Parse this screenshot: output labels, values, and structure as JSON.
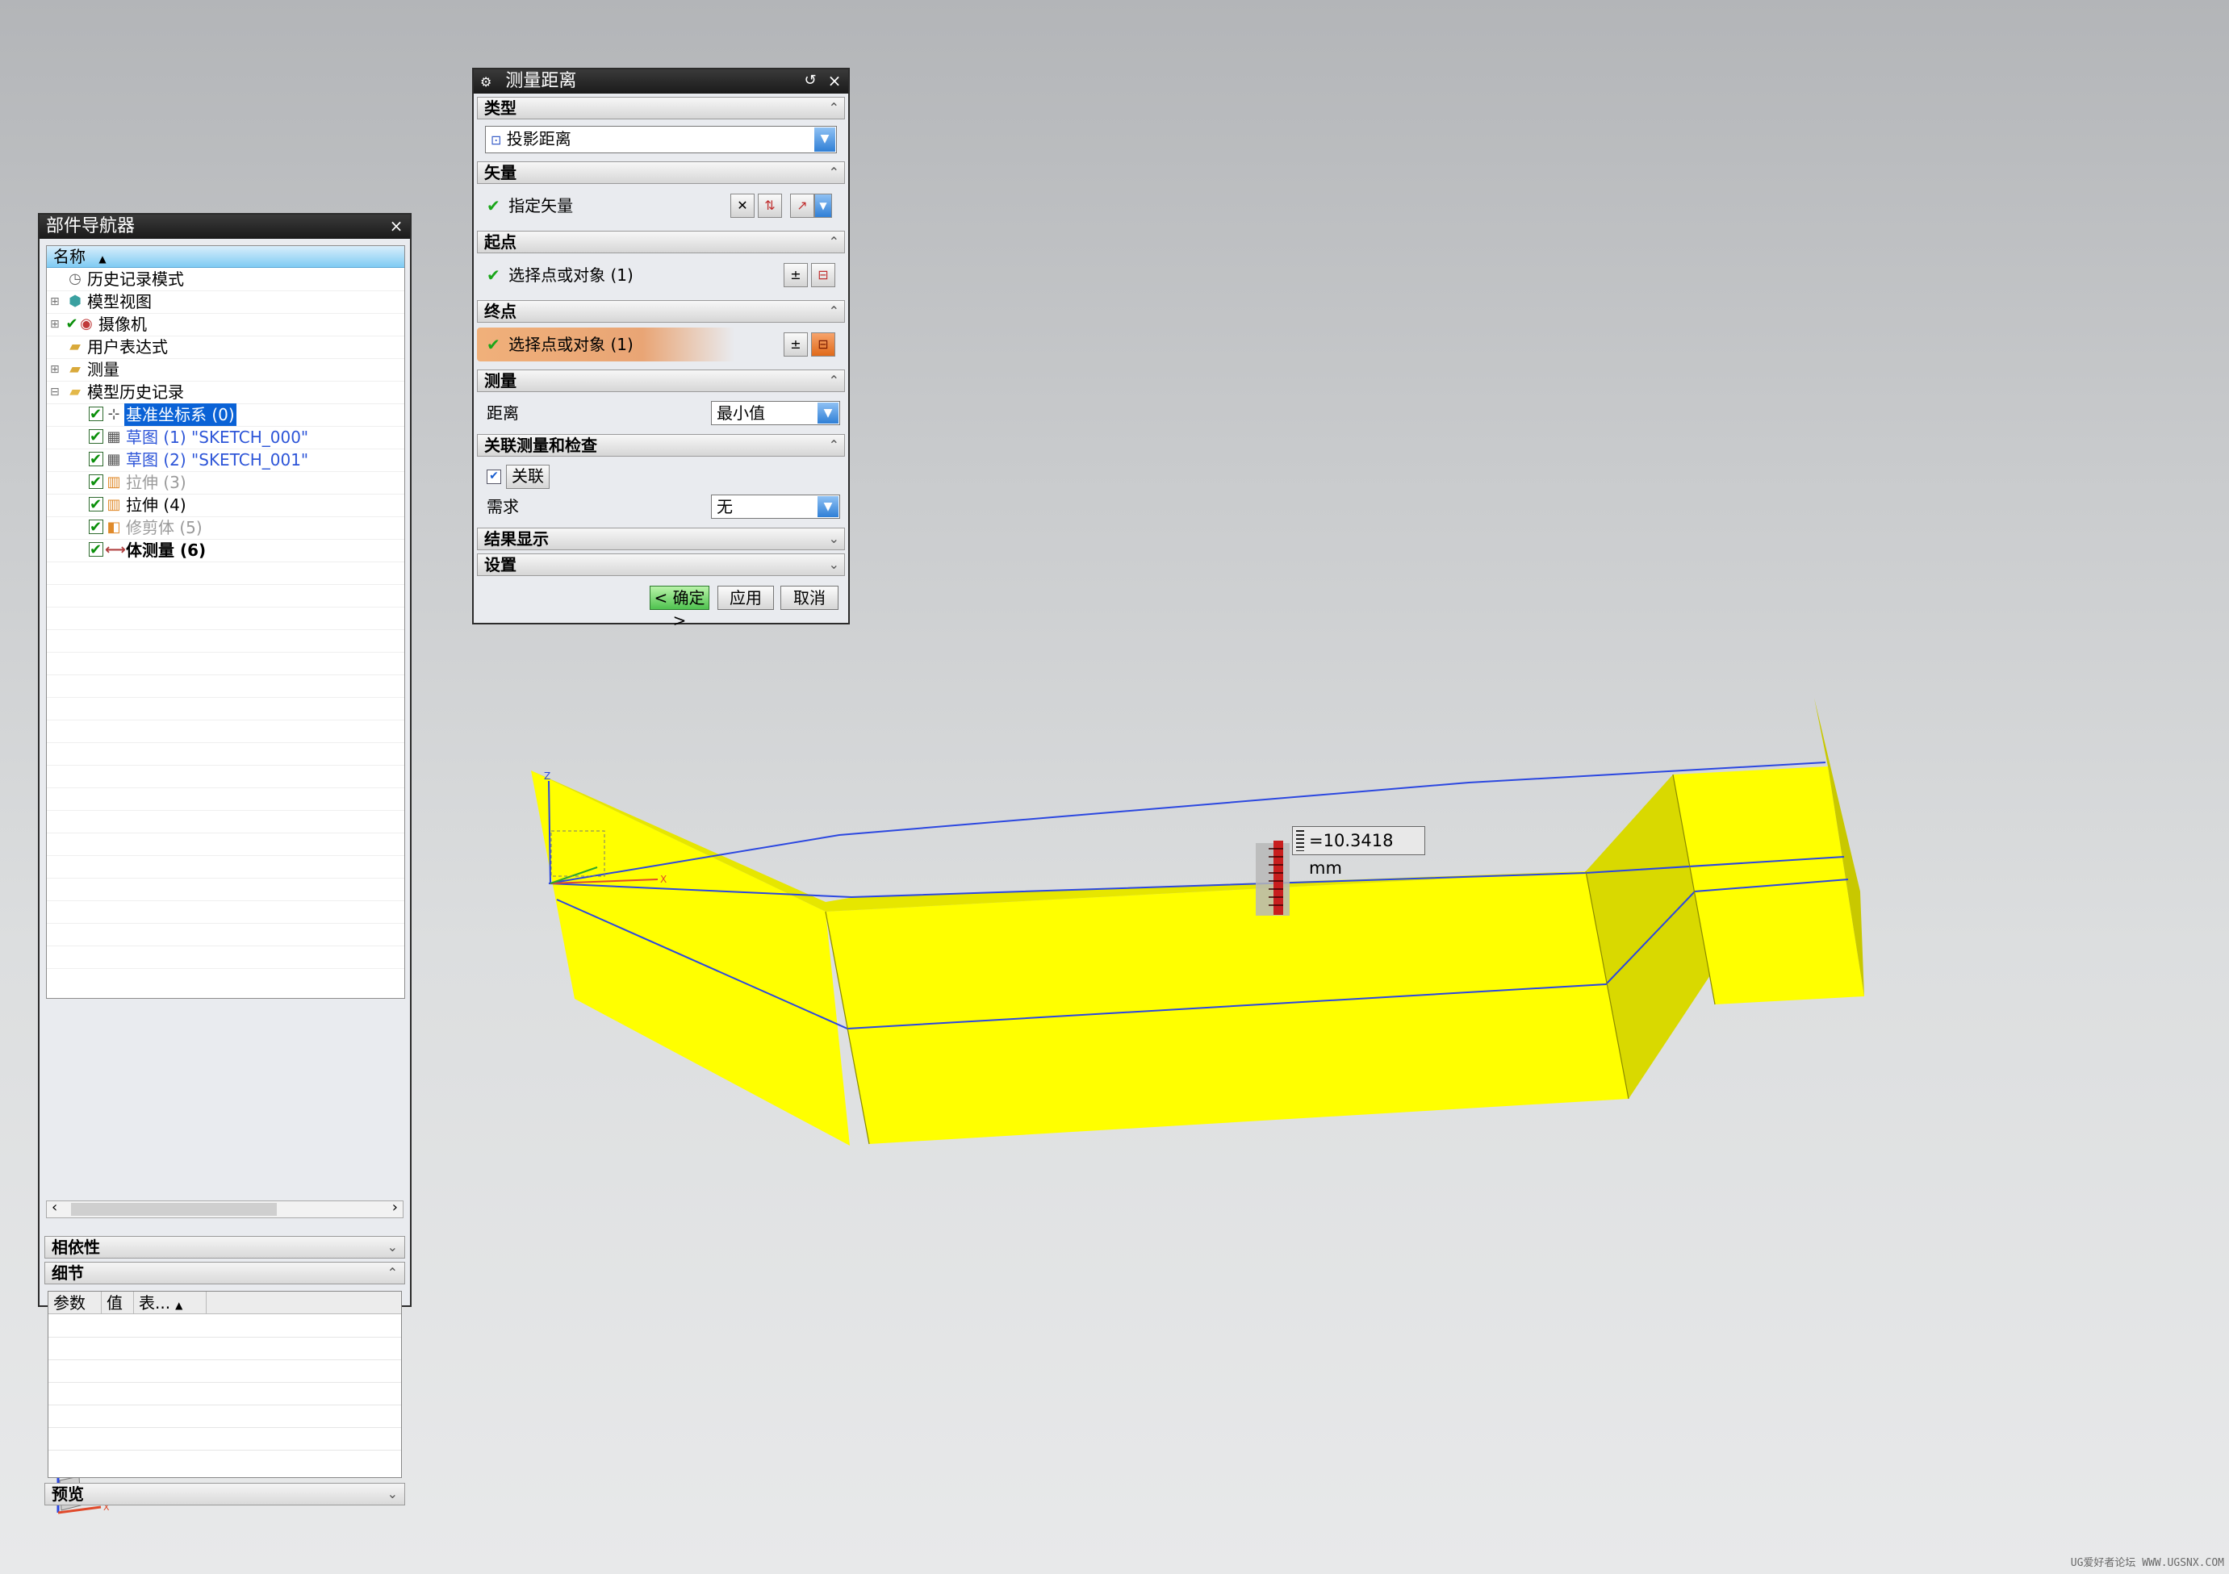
{
  "navigator": {
    "title": "部件导航器",
    "close": "×",
    "column_header": "名称",
    "sort_arrow": "▲",
    "items": [
      {
        "label": "历史记录模式",
        "icon": "clock-icon",
        "style": "normal"
      },
      {
        "label": "模型视图",
        "icon": "view-icon",
        "style": "normal"
      },
      {
        "label": "摄像机",
        "icon": "camera-icon",
        "style": "normal"
      },
      {
        "label": "用户表达式",
        "icon": "folder-icon",
        "style": "normal"
      },
      {
        "label": "测量",
        "icon": "folder-icon",
        "style": "normal"
      },
      {
        "label": "模型历史记录",
        "icon": "folder-icon",
        "style": "normal"
      },
      {
        "label": "基准坐标系 (0)",
        "icon": "csys-icon",
        "style": "selected"
      },
      {
        "label": "草图 (1) \"SKETCH_000\"",
        "icon": "sketch-icon",
        "style": "blue"
      },
      {
        "label": "草图 (2) \"SKETCH_001\"",
        "icon": "sketch-icon",
        "style": "blue"
      },
      {
        "label": "拉伸 (3)",
        "icon": "extrude-icon",
        "style": "dim"
      },
      {
        "label": "拉伸 (4)",
        "icon": "extrude-icon",
        "style": "normal"
      },
      {
        "label": "修剪体 (5)",
        "icon": "trim-icon",
        "style": "dim"
      },
      {
        "label": "体测量 (6)",
        "icon": "measure-icon",
        "style": "bold"
      }
    ],
    "dependencies_label": "相依性",
    "details_label": "细节",
    "details_columns": [
      "参数",
      "值",
      "表..."
    ],
    "preview_label": "预览"
  },
  "dialog": {
    "title": "测量距离",
    "type_section": "类型",
    "type_value": "投影距离",
    "vector_section": "矢量",
    "vector_label": "指定矢量",
    "start_section": "起点",
    "start_label": "选择点或对象 (1)",
    "end_section": "终点",
    "end_label": "选择点或对象 (1)",
    "measure_section": "测量",
    "distance_label": "距离",
    "distance_value": "最小值",
    "assoc_section": "关联测量和检查",
    "assoc_checkbox": "关联",
    "requirement_label": "需求",
    "requirement_value": "无",
    "results_section": "结果显示",
    "settings_section": "设置",
    "ok_button": "< 确定 >",
    "apply_button": "应用",
    "cancel_button": "取消"
  },
  "viewport": {
    "measurement": "=10.3418 mm",
    "axis_z": "Z",
    "axis_x": "X",
    "watermark": "UG爱好者论坛 WWW.UGSNX.COM",
    "colors": {
      "solid_face": "#ffff00",
      "solid_side": "#d8d800",
      "edge": "#2b47e0"
    }
  }
}
